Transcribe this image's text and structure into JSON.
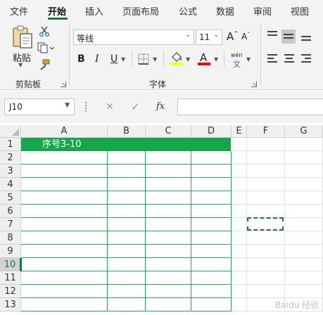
{
  "ribbon_tabs": [
    {
      "label": "文件",
      "active": false
    },
    {
      "label": "开始",
      "active": true
    },
    {
      "label": "插入",
      "active": false
    },
    {
      "label": "页面布局",
      "active": false
    },
    {
      "label": "公式",
      "active": false
    },
    {
      "label": "数据",
      "active": false
    },
    {
      "label": "审阅",
      "active": false
    },
    {
      "label": "视图",
      "active": false
    }
  ],
  "clipboard": {
    "paste_label": "粘贴",
    "group_label": "剪贴板"
  },
  "font": {
    "group_label": "字体",
    "font_name": "等线",
    "font_size": "11",
    "grow_label": "A",
    "shrink_label": "A",
    "bold_label": "B",
    "italic_label": "I",
    "underline_label": "U",
    "font_color_label": "A",
    "phonetic_top": "wén",
    "phonetic_bottom": "文"
  },
  "colors": {
    "accent": "#217346",
    "header_fill": "#19a54c",
    "highlight_yellow": "#ffff00",
    "font_red": "#e00000"
  },
  "formula_bar": {
    "name_box": "J10",
    "cancel_icon": "✕",
    "enter_icon": "✓",
    "fx_label": "fx",
    "formula_value": ""
  },
  "sheet": {
    "columns": [
      "A",
      "B",
      "C",
      "D",
      "E",
      "F",
      "G"
    ],
    "rows": [
      "1",
      "2",
      "3",
      "4",
      "5",
      "6",
      "7",
      "8",
      "9",
      "10",
      "11",
      "12",
      "13"
    ],
    "title_text": "序号3-10",
    "selected_row": "10"
  },
  "watermark": "Baidu 经验"
}
